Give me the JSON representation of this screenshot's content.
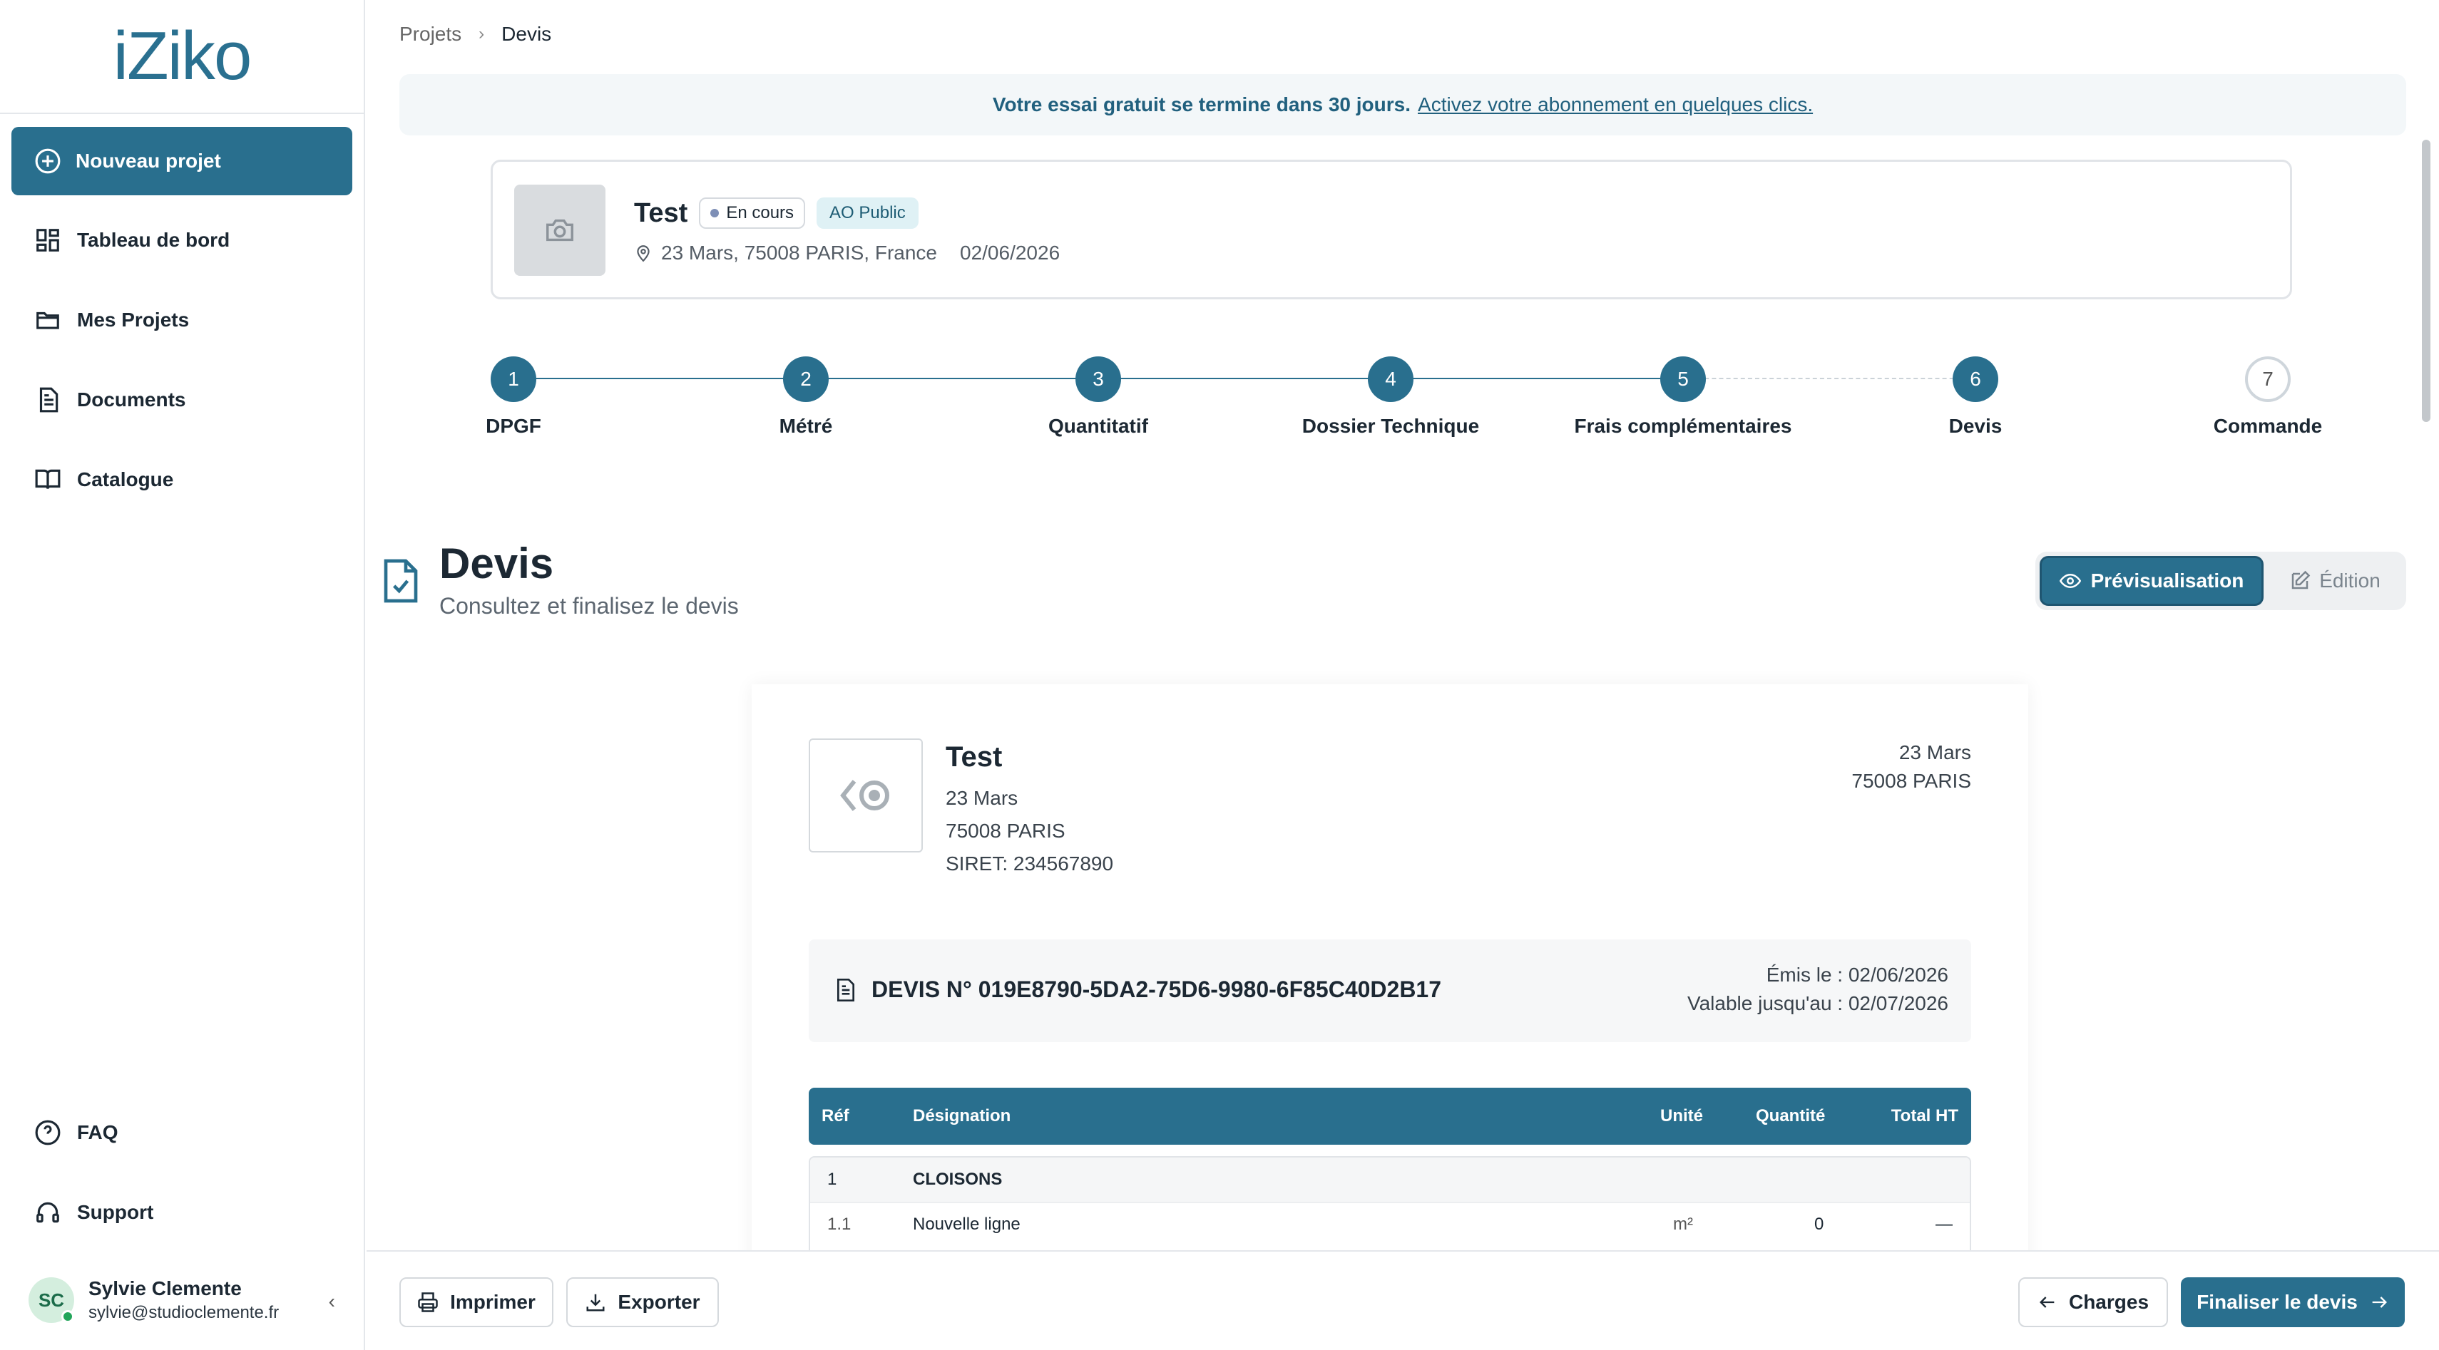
{
  "brand": {
    "logo": "iZiko",
    "color": "#296f8e"
  },
  "sidebar": {
    "new_project": "Nouveau projet",
    "items": [
      {
        "label": "Tableau de bord",
        "icon": "dashboard-icon"
      },
      {
        "label": "Mes Projets",
        "icon": "folder-icon"
      },
      {
        "label": "Documents",
        "icon": "document-icon"
      },
      {
        "label": "Catalogue",
        "icon": "book-icon"
      }
    ],
    "bottom_items": [
      {
        "label": "FAQ",
        "icon": "help-circle-icon"
      },
      {
        "label": "Support",
        "icon": "headset-icon"
      }
    ],
    "user": {
      "initials": "SC",
      "name": "Sylvie Clemente",
      "email": "sylvie@studioclemente.fr"
    }
  },
  "breadcrumb": {
    "parent": "Projets",
    "current": "Devis"
  },
  "trial": {
    "message": "Votre essai gratuit se termine dans 30 jours.",
    "link": "Activez votre abonnement en quelques clics."
  },
  "project": {
    "name": "Test",
    "status": "En cours",
    "type": "AO Public",
    "address": "23 Mars, 75008 PARIS, France",
    "date": "02/06/2026"
  },
  "steps": [
    {
      "num": "1",
      "label": "DPGF",
      "done": true
    },
    {
      "num": "2",
      "label": "Métré",
      "done": true
    },
    {
      "num": "3",
      "label": "Quantitatif",
      "done": true
    },
    {
      "num": "4",
      "label": "Dossier Technique",
      "done": true
    },
    {
      "num": "5",
      "label": "Frais complémentaires",
      "done": true
    },
    {
      "num": "6",
      "label": "Devis",
      "done": true
    },
    {
      "num": "7",
      "label": "Commande",
      "done": false
    }
  ],
  "section": {
    "title": "Devis",
    "subtitle": "Consultez et finalisez le devis"
  },
  "view_toggle": {
    "preview": "Prévisualisation",
    "edit": "Édition"
  },
  "quote": {
    "company": {
      "name": "Test",
      "street": "23 Mars",
      "city": "75008 PARIS",
      "siret": "SIRET: 234567890"
    },
    "client": {
      "street": "23 Mars",
      "city": "75008 PARIS"
    },
    "number": "DEVIS N° 019E8790-5DA2-75D6-9980-6F85C40D2B17",
    "issued": "Émis le : 02/06/2026",
    "valid": "Valable jusqu'au : 02/07/2026",
    "columns": {
      "ref": "Réf",
      "designation": "Désignation",
      "unit": "Unité",
      "qty": "Quantité",
      "total": "Total HT"
    },
    "group": {
      "ref": "1",
      "designation": "CLOISONS"
    },
    "row": {
      "ref": "1.1",
      "designation": "Nouvelle ligne",
      "unit": "m²",
      "qty": "0",
      "total": "—"
    }
  },
  "footer": {
    "print": "Imprimer",
    "export": "Exporter",
    "back": "Charges",
    "finalize": "Finaliser le devis"
  }
}
